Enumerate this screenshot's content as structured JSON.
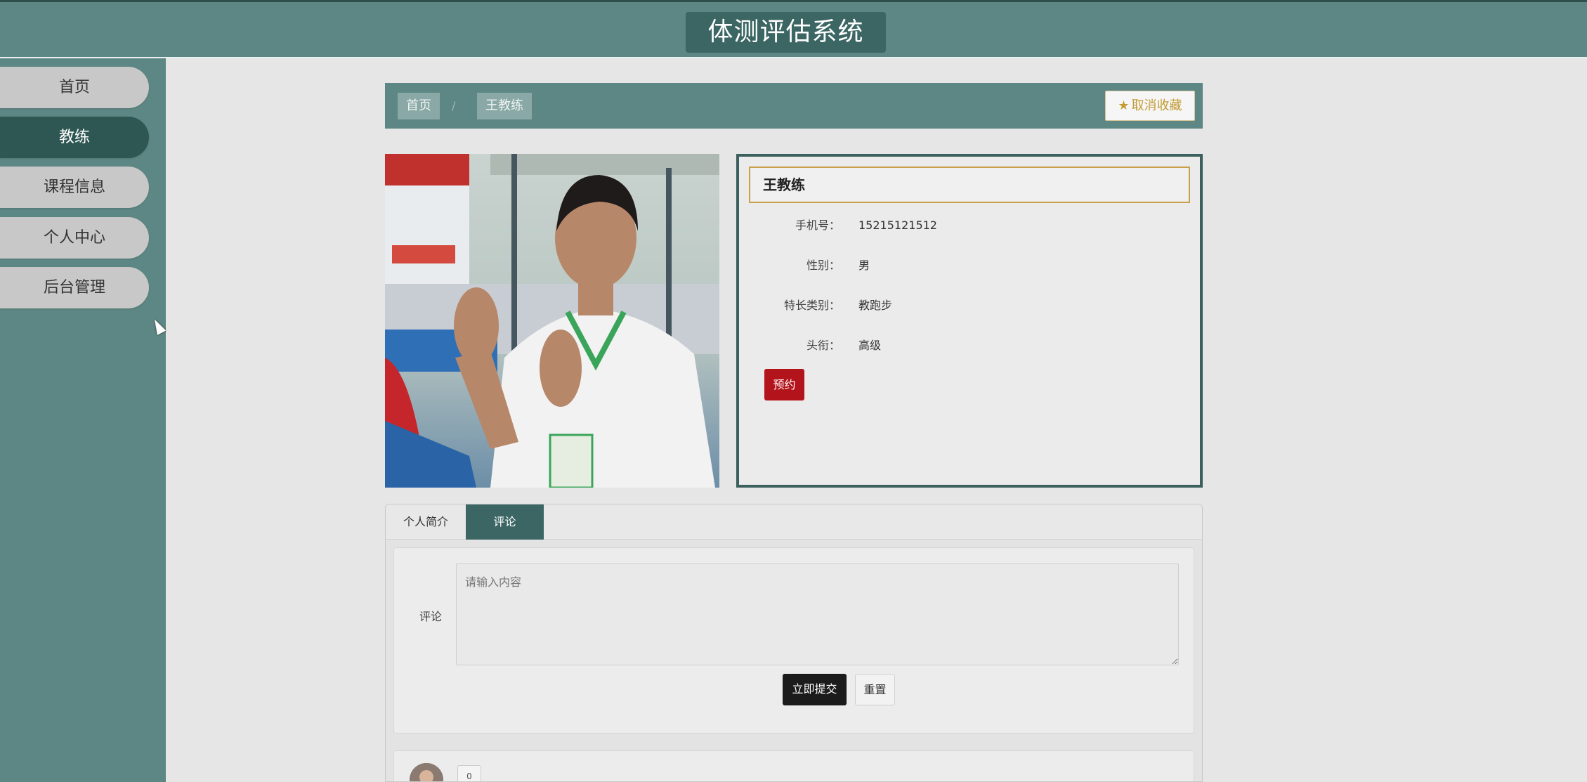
{
  "header": {
    "title": "体测评估系统"
  },
  "sidebar": {
    "items": [
      {
        "label": "首页"
      },
      {
        "label": "教练"
      },
      {
        "label": "课程信息"
      },
      {
        "label": "个人中心"
      },
      {
        "label": "后台管理"
      }
    ],
    "active_index": 1
  },
  "breadcrumb": {
    "home": "首页",
    "separator": "/",
    "current": "王教练",
    "favorite_icon": "star-icon",
    "favorite_label": "取消收藏"
  },
  "coach": {
    "name": "王教练",
    "fields": [
      {
        "label": "手机号：",
        "value": "15215121512"
      },
      {
        "label": "性别：",
        "value": "男"
      },
      {
        "label": "特长类别：",
        "value": "教跑步"
      },
      {
        "label": "头衔：",
        "value": "高级"
      }
    ],
    "book_label": "预约"
  },
  "tabs": [
    {
      "label": "个人简介"
    },
    {
      "label": "评论"
    }
  ],
  "comment_form": {
    "label": "评论",
    "placeholder": "请输入内容",
    "submit_label": "立即提交",
    "reset_label": "重置"
  },
  "comment_list": {
    "first_item_button": "0"
  },
  "colors": {
    "primary": "#5d8784",
    "active": "#2e5653",
    "accent_gold": "#c39b35",
    "book_red": "#b3141b"
  }
}
